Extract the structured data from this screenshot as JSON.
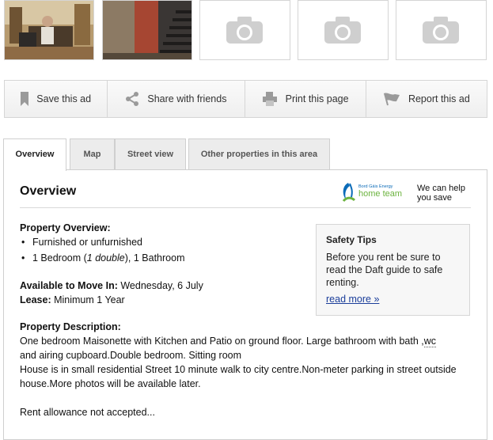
{
  "photos": [
    {
      "name": "photo-living-room"
    },
    {
      "name": "photo-stairs"
    },
    {
      "name": "photo-placeholder"
    },
    {
      "name": "photo-placeholder"
    },
    {
      "name": "photo-placeholder"
    }
  ],
  "actions": {
    "save": {
      "label": "Save this ad",
      "icon": "bookmark-icon"
    },
    "share": {
      "label": "Share with friends",
      "icon": "share-icon"
    },
    "print": {
      "label": "Print this page",
      "icon": "printer-icon"
    },
    "report": {
      "label": "Report this ad",
      "icon": "flag-icon"
    }
  },
  "tabs": [
    {
      "label": "Overview",
      "active": true
    },
    {
      "label": "Map",
      "active": false
    },
    {
      "label": "Street view",
      "active": false
    },
    {
      "label": "Other properties in this area",
      "active": false
    }
  ],
  "overview": {
    "title": "Overview",
    "logo": {
      "small_text": "Bord Gáis Energy",
      "main_text": "home team"
    },
    "tagline_line1": "We can help",
    "tagline_line2": "you save",
    "property_overview_heading": "Property Overview:",
    "bullets": {
      "furnished": "Furnished or unfurnished",
      "bedroom_prefix": "1 Bedroom (",
      "bedroom_em": "1 double",
      "bedroom_suffix": "), 1 Bathroom"
    },
    "available_label": "Available to Move In:",
    "available_value": "Wednesday, 6 July",
    "lease_label": "Lease:",
    "lease_value": "Minimum 1 Year",
    "description_heading": "Property Description:",
    "description_line1": "One bedroom Maisonette with Kitchen and Patio on ground floor. Large bathroom with bath ,",
    "description_wc": "wc",
    "description_line2": "and airing cupboard.Double bedroom. Sitting room",
    "description_para2": "House is in small residential Street 10 minute walk to city centre.Non-meter parking in street outside house.More photos will be available later.",
    "description_para3": "Rent allowance not accepted..."
  },
  "safety_tips": {
    "title": "Safety Tips",
    "body": "Before you rent be sure to read the Daft guide to safe renting.",
    "link": "read more »"
  },
  "colors": {
    "link": "#1a3d9a",
    "logo_blue": "#0b6bb8",
    "logo_green": "#6cb33f"
  }
}
